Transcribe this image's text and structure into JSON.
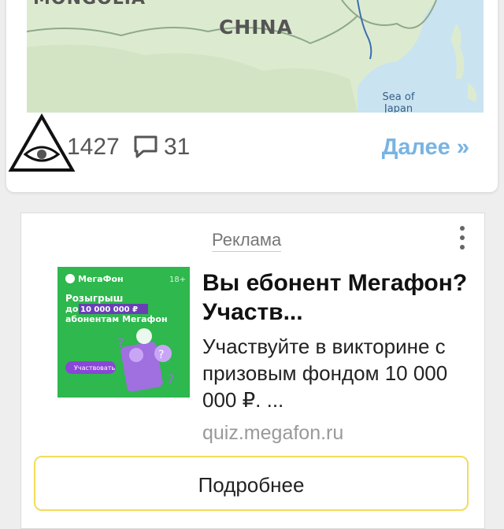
{
  "post": {
    "map": {
      "labels": {
        "mongolia": "MONGOLIA",
        "china": "CHINA",
        "sea_line1": "Sea of",
        "sea_line2": "Japan"
      }
    },
    "views_count": "1427",
    "comments_count": "31",
    "more_link": "Далее »"
  },
  "ad": {
    "label": "Реклама",
    "image": {
      "brand": "МегаФон",
      "age": "18+",
      "line1": "Розыгрыш",
      "line2_prefix": "до",
      "line2_amount": "10 000 000 ₽",
      "line3": "абонентам Мегафон",
      "button": "Участвовать"
    },
    "title": "Вы ебонент Мегафон? Участв...",
    "description": "Участвуйте в викторине с призовым фондом 10 000 000 ₽. ...",
    "domain": "quiz.megafon.ru",
    "cta": "Подробнее"
  },
  "colors": {
    "link": "#78b4e3",
    "ad_green": "#2eb84d",
    "cta_border": "#f2dc5c"
  },
  "icons": [
    "eye-triangle-logo-icon",
    "comment-bubble-icon",
    "more-vertical-icon"
  ]
}
